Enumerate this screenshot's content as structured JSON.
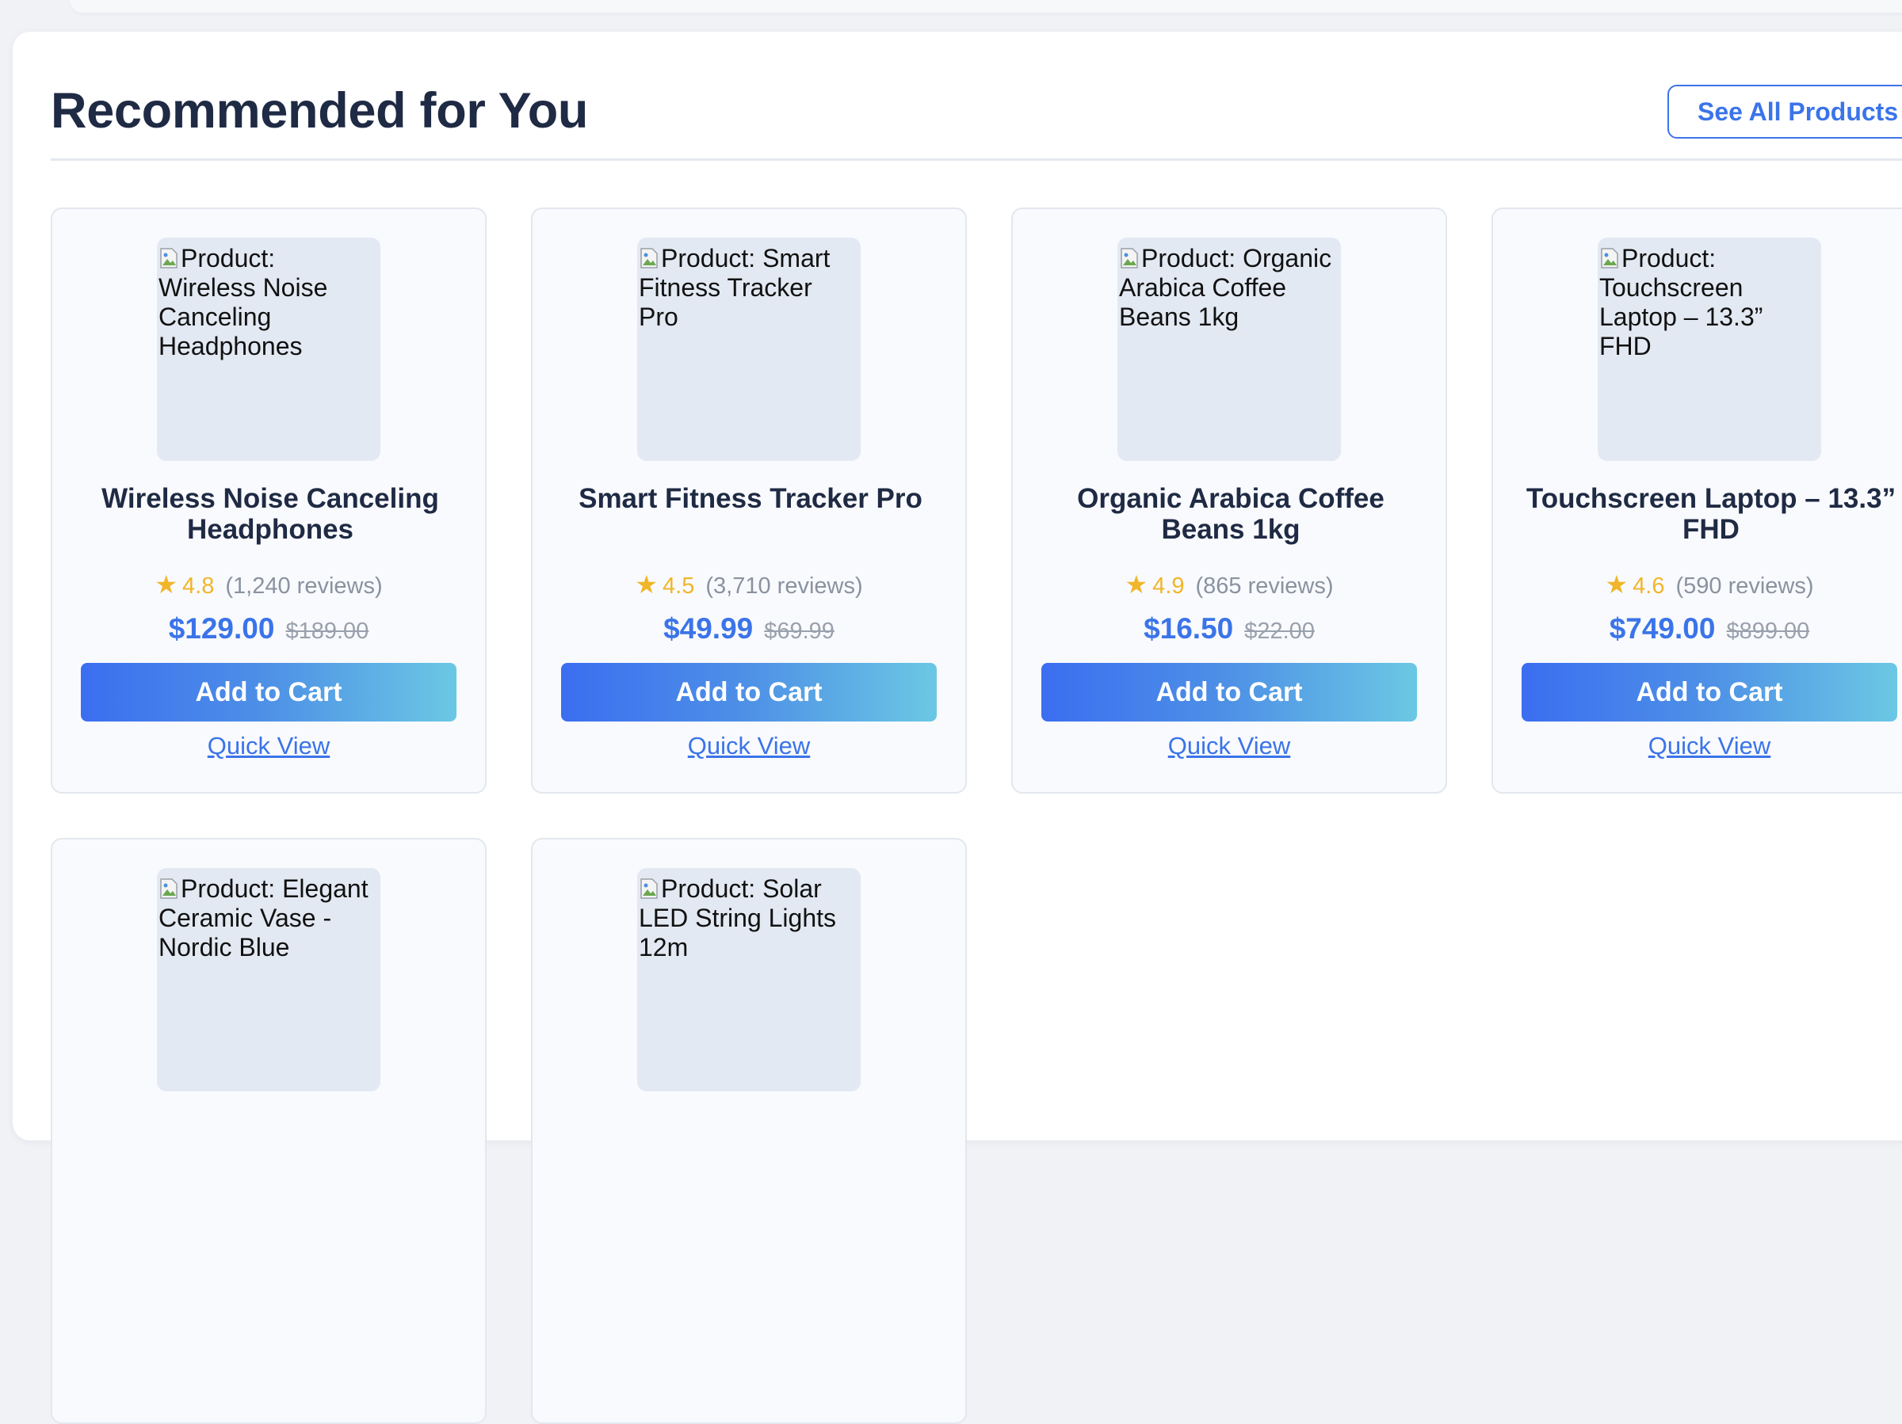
{
  "section": {
    "title": "Recommended for You",
    "see_all_label": "See All Products"
  },
  "colors": {
    "accent": "#3b74e9",
    "title": "#1f2a44",
    "star": "#f1b52a",
    "muted": "#8a92a0",
    "button_gradient_start": "#3b6ef0",
    "button_gradient_end": "#6bc8e4"
  },
  "products": [
    {
      "image_alt": "Product: Wireless Noise Canceling Headphones",
      "name": "Wireless Noise Canceling Headphones",
      "star": "★",
      "rating": "4.8",
      "reviews": "(1,240 reviews)",
      "price": "$129.00",
      "old_price": "$189.00",
      "add_to_cart": "Add to Cart",
      "quick_view": "Quick View"
    },
    {
      "image_alt": "Product: Smart Fitness Tracker Pro",
      "name": "Smart Fitness Tracker Pro",
      "star": "★",
      "rating": "4.5",
      "reviews": "(3,710 reviews)",
      "price": "$49.99",
      "old_price": "$69.99",
      "add_to_cart": "Add to Cart",
      "quick_view": "Quick View"
    },
    {
      "image_alt": "Product: Organic Arabica Coffee Beans 1kg",
      "name": "Organic Arabica Coffee Beans 1kg",
      "star": "★",
      "rating": "4.9",
      "reviews": "(865 reviews)",
      "price": "$16.50",
      "old_price": "$22.00",
      "add_to_cart": "Add to Cart",
      "quick_view": "Quick View"
    },
    {
      "image_alt": "Product: Touchscreen Laptop – 13.3” FHD",
      "name": "Touchscreen Laptop – 13.3” FHD",
      "star": "★",
      "rating": "4.6",
      "reviews": "(590 reviews)",
      "price": "$749.00",
      "old_price": "$899.00",
      "add_to_cart": "Add to Cart",
      "quick_view": "Quick View"
    },
    {
      "image_alt": "Product: Elegant Ceramic Vase - Nordic Blue"
    },
    {
      "image_alt": "Product: Solar LED String Lights 12m"
    }
  ]
}
